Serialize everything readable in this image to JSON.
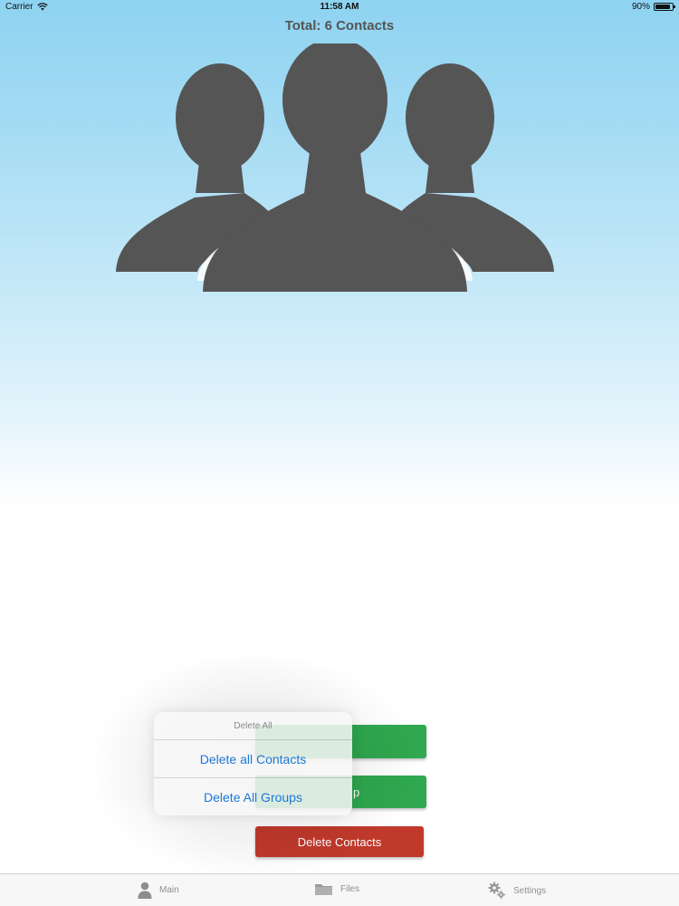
{
  "status_bar": {
    "carrier": "Carrier",
    "time": "11:58 AM",
    "battery": "90%",
    "battery_level": 0.9
  },
  "header": {
    "title": "Total: 6 Contacts"
  },
  "buttons": {
    "third_label": "Delete Contacts",
    "second_partial_label": "p"
  },
  "action_sheet": {
    "title": "Delete All",
    "items": [
      {
        "label": "Delete all Contacts"
      },
      {
        "label": "Delete All Groups"
      }
    ]
  },
  "tab_bar": {
    "tabs": [
      {
        "label": "Main",
        "icon": "person-icon"
      },
      {
        "label": "Files",
        "icon": "folder-icon"
      },
      {
        "label": "Settings",
        "icon": "gear-icon"
      }
    ]
  },
  "colors": {
    "green_button": "#2fa84f",
    "red_button": "#c0392b",
    "link_blue": "#1a78d6",
    "silhouette": "#555555"
  }
}
